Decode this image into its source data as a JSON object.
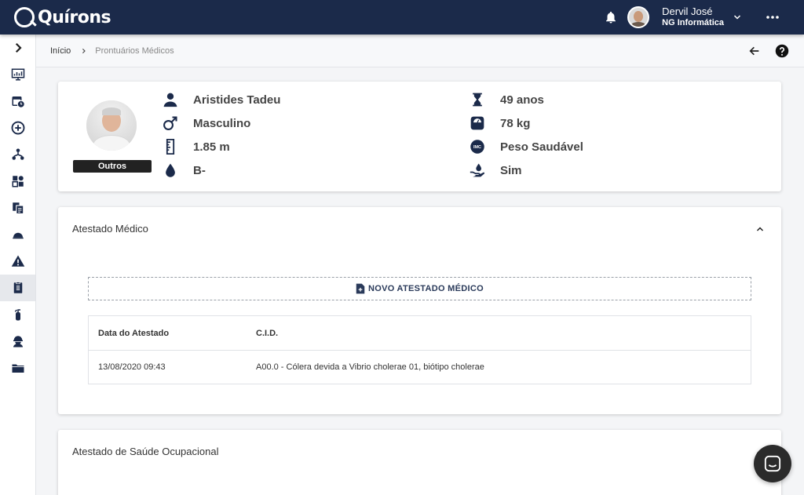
{
  "app": {
    "name": "Quírons"
  },
  "user": {
    "name": "Dervil José",
    "organization": "NG Informática"
  },
  "breadcrumb": {
    "home": "Início",
    "current": "Prontuários Médicos"
  },
  "patient": {
    "category": "Outros",
    "name": "Aristides Tadeu",
    "sex": "Masculino",
    "height": "1.85 m",
    "blood_type": "B-",
    "age": "49 anos",
    "weight": "78 kg",
    "bmi_status": "Peso Saudável",
    "organ_donor": "Sim",
    "bmi_icon_label": "IMC"
  },
  "atestado": {
    "title": "Atestado Médico",
    "new_button": "NOVO ATESTADO MÉDICO",
    "columns": [
      "Data do Atestado",
      "C.I.D."
    ],
    "rows": [
      {
        "date": "13/08/2020 09:43",
        "cid": "A00.0 - Cólera devida a Vibrio cholerae 01, biótipo cholerae"
      }
    ]
  },
  "ocupacional": {
    "title": "Atestado de Saúde Ocupacional"
  },
  "colors": {
    "topbar": "#1b2a4a",
    "accent": "#2a3a5a"
  },
  "icons": {
    "sidebar": [
      "chevron-right-icon",
      "monitor-chart-icon",
      "calendar-clock-icon",
      "plus-circle-icon",
      "org-chart-icon",
      "puzzle-icon",
      "documents-icon",
      "hard-hat-icon",
      "warning-icon",
      "medical-record-icon",
      "fire-extinguisher-icon",
      "worker-icon",
      "folder-icon"
    ]
  }
}
